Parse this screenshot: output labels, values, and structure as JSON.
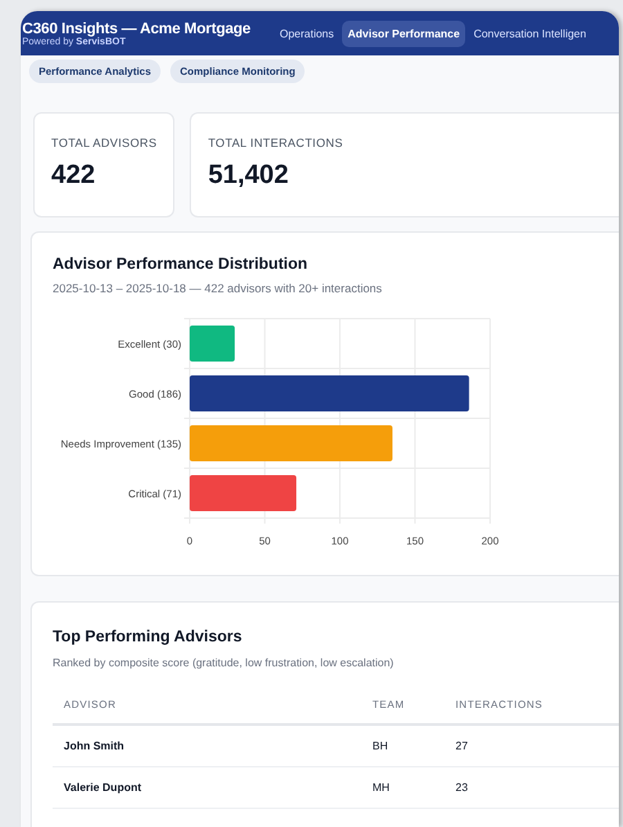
{
  "header": {
    "title": "C360 Insights — Acme Mortgage",
    "subtitle": "Powered by **ServisBOT**"
  },
  "tabs": [
    {
      "label": "Operations",
      "selected": false
    },
    {
      "label": "Advisor Performance",
      "selected": true
    },
    {
      "label": "Conversation Intelligen",
      "selected": false
    }
  ],
  "subtabs": [
    {
      "label": "Performance Analytics"
    },
    {
      "label": "Compliance Monitoring"
    }
  ],
  "stats": [
    {
      "label": "TOTAL ADVISORS",
      "value": "422"
    },
    {
      "label": "TOTAL INTERACTIONS",
      "value": "51,402"
    }
  ],
  "distribution": {
    "title": "Advisor Performance Distribution",
    "subtitle": "2025-10-13 – 2025-10-18 — 422 advisors with 20+ interactions",
    "chart_data": {
      "type": "bar",
      "orientation": "horizontal",
      "categories": [
        "Excellent (30)",
        "Good (186)",
        "Needs Improvement (135)",
        "Critical (71)"
      ],
      "values": [
        30,
        186,
        135,
        71
      ],
      "grid": true,
      "colors": [
        "#10b981",
        "#1e3a8a",
        "#f59e0b",
        "#ef4444"
      ],
      "xlim": [
        0,
        200
      ],
      "xticks": [
        0,
        50,
        100,
        150,
        200
      ]
    }
  },
  "top_advisors": {
    "title": "Top Performing Advisors",
    "subtitle": "Ranked by composite score (gratitude, low frustration, low escalation)",
    "columns": [
      "ADVISOR",
      "TEAM",
      "INTERACTIONS"
    ],
    "rows": [
      [
        "John Smith",
        "BH",
        "27"
      ],
      [
        "Valerie Dupont",
        "MH",
        "23"
      ]
    ]
  }
}
